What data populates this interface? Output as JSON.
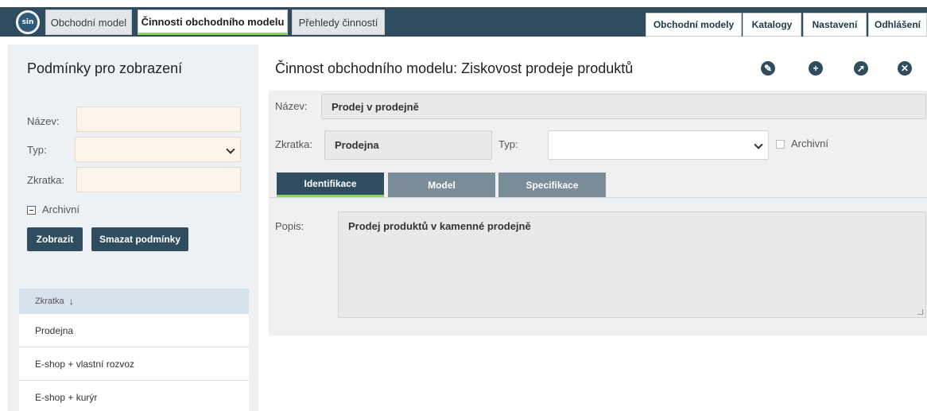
{
  "app": {
    "logo_text": "sin"
  },
  "top_tabs": [
    {
      "label": "Obchodní model"
    },
    {
      "label": "Činnosti obchodního modelu"
    },
    {
      "label": "Přehledy činností"
    }
  ],
  "top_nav": [
    {
      "label": "Obchodní modely"
    },
    {
      "label": "Katalogy"
    },
    {
      "label": "Nastavení"
    },
    {
      "label": "Odhlášení"
    }
  ],
  "filter": {
    "title": "Podmínky pro zobrazení",
    "name_label": "Název:",
    "name_value": "",
    "type_label": "Typ:",
    "type_value": "",
    "abbr_label": "Zkratka:",
    "abbr_value": "",
    "archive_label": "Archivní",
    "show_button": "Zobrazit",
    "clear_button": "Smazat podmínky"
  },
  "grid": {
    "column_header": "Zkratka",
    "sort_icon": "arrow-down-icon",
    "rows": [
      "Prodejna",
      "E-shop + vlastní rozvoz",
      "E-shop + kurýr"
    ]
  },
  "detail": {
    "title": "Činnost obchodního modelu: Ziskovost prodeje produktů",
    "icons": [
      "edit-icon",
      "add-icon",
      "rocket-icon",
      "close-icon"
    ],
    "name_label": "Název:",
    "name_value": "Prodej v prodejně",
    "abbr_label": "Zkratka:",
    "abbr_value": "Prodejna",
    "type_label": "Typ:",
    "type_value": "",
    "archive_label": "Archivní",
    "tabs": [
      {
        "label": "Identifikace"
      },
      {
        "label": "Model"
      },
      {
        "label": "Specifikace"
      }
    ],
    "desc_label": "Popis:",
    "desc_value": "Prodej produktů v kamenné prodejně"
  },
  "colors": {
    "primary": "#2f4d5f",
    "accent_green": "#8cd45a",
    "tab_inactive": "#7a8d99",
    "input_bg": "#fdf5ea"
  }
}
